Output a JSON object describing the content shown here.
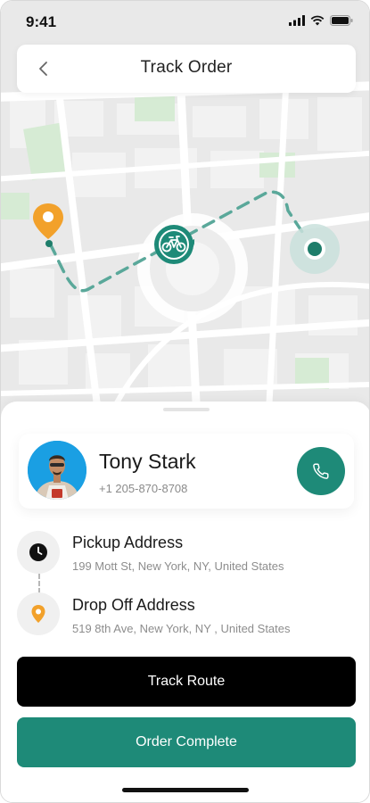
{
  "status_bar": {
    "time": "9:41"
  },
  "header": {
    "title": "Track Order"
  },
  "driver": {
    "name": "Tony Stark",
    "phone": "+1 205-870-8708"
  },
  "pickup": {
    "title": "Pickup Address",
    "address": "199 Mott St, New York, NY, United States"
  },
  "dropoff": {
    "title": "Drop Off Address",
    "address": "519 8th Ave, New York, NY , United States"
  },
  "buttons": {
    "track_route": "Track Route",
    "order_complete": "Order Complete"
  },
  "colors": {
    "accent": "#1e8a78",
    "pin_orange": "#f2a12b",
    "map_bg": "#ececec",
    "map_green": "#d7ecd6",
    "primary_button": "#000000"
  },
  "icons": {
    "back": "chevron-left-icon",
    "origin": "map-pin-icon",
    "rider": "bicycle-icon",
    "destination": "destination-dot-icon",
    "call": "phone-icon",
    "pickup": "clock-icon",
    "dropoff": "location-pin-icon"
  }
}
